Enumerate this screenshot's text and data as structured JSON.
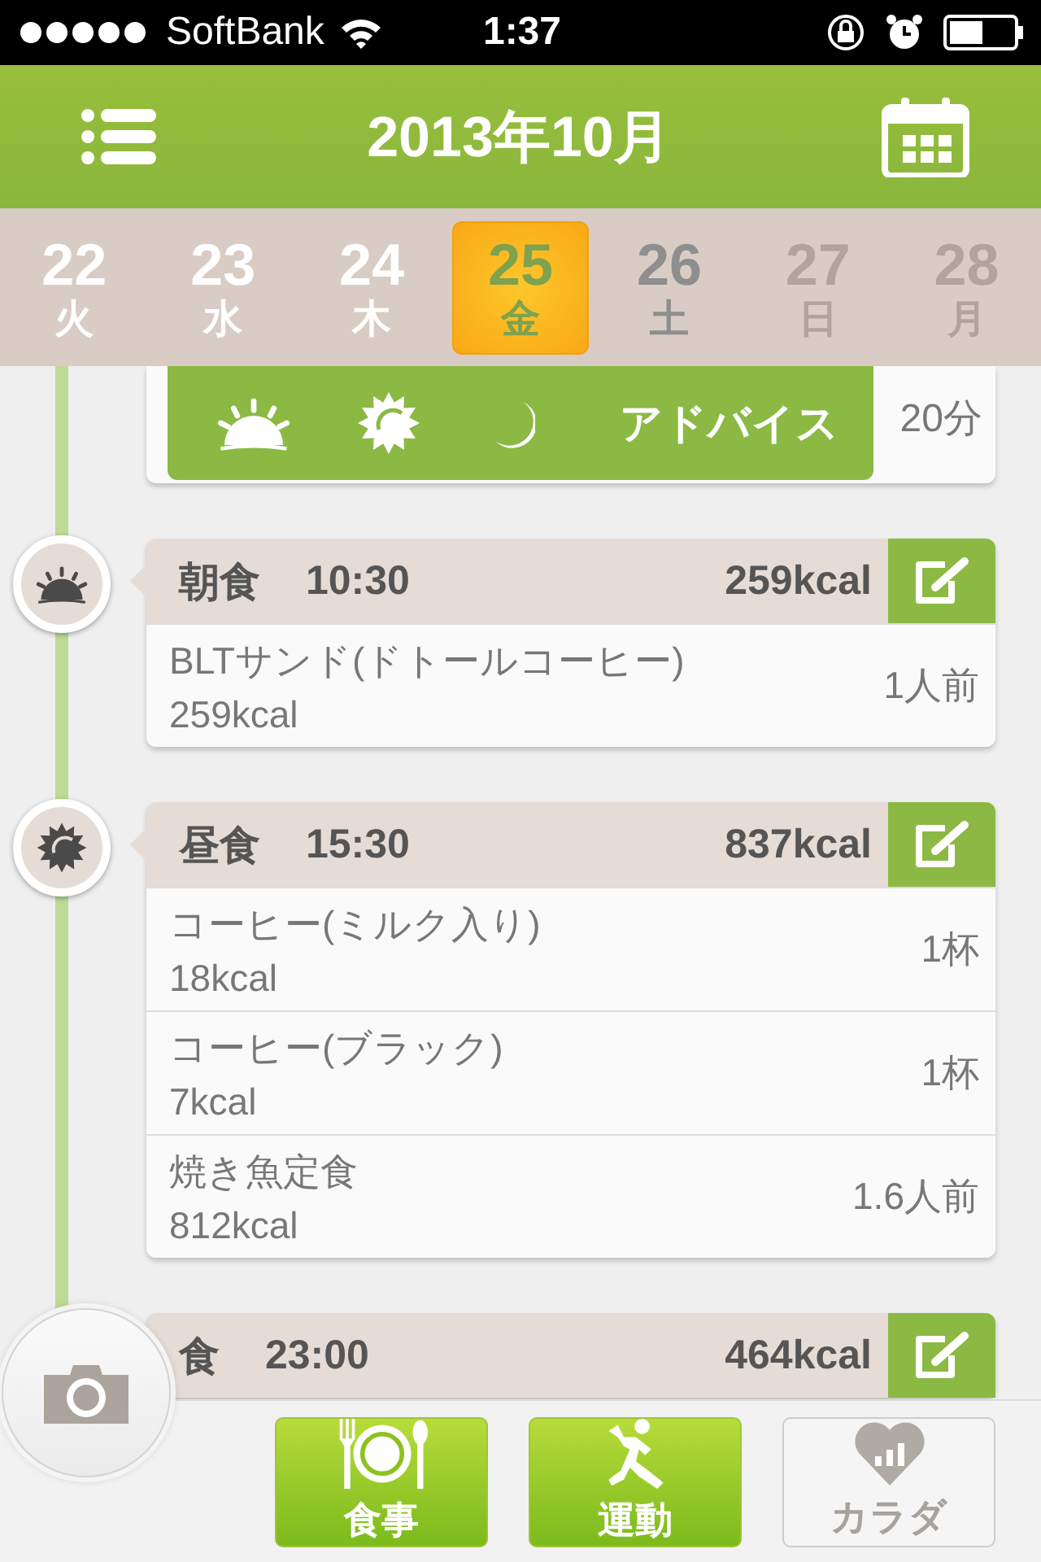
{
  "status_bar": {
    "carrier": "SoftBank",
    "time": "1:37"
  },
  "header": {
    "title": "2013年10月"
  },
  "days": [
    {
      "date": "22",
      "weekday": "火",
      "selected": false,
      "kind": "past"
    },
    {
      "date": "23",
      "weekday": "水",
      "selected": false,
      "kind": "past"
    },
    {
      "date": "24",
      "weekday": "木",
      "selected": false,
      "kind": "past"
    },
    {
      "date": "25",
      "weekday": "金",
      "selected": true,
      "kind": "past"
    },
    {
      "date": "26",
      "weekday": "土",
      "selected": false,
      "kind": "today"
    },
    {
      "date": "27",
      "weekday": "日",
      "selected": false,
      "kind": "future"
    },
    {
      "date": "28",
      "weekday": "月",
      "selected": false,
      "kind": "future"
    }
  ],
  "advice": {
    "label": "アドバイス",
    "duration": "20分"
  },
  "meals": [
    {
      "kind": "breakfast",
      "title": "朝食",
      "time": "10:30",
      "kcal": "259kcal",
      "items": [
        {
          "name": "BLTサンド(ドトールコーヒー)",
          "kcal": "259kcal",
          "portion": "1人前"
        }
      ]
    },
    {
      "kind": "lunch",
      "title": "昼食",
      "time": "15:30",
      "kcal": "837kcal",
      "items": [
        {
          "name": "コーヒー(ミルク入り)",
          "kcal": "18kcal",
          "portion": "1杯"
        },
        {
          "name": "コーヒー(ブラック)",
          "kcal": "7kcal",
          "portion": "1杯"
        },
        {
          "name": "焼き魚定食",
          "kcal": "812kcal",
          "portion": "1.6人前"
        }
      ]
    },
    {
      "kind": "dinner",
      "title": "食",
      "time": "23:00",
      "kcal": "464kcal"
    }
  ],
  "tabs": [
    {
      "kind": "meal",
      "label": "食事",
      "enabled": true
    },
    {
      "kind": "exercise",
      "label": "運動",
      "enabled": true
    },
    {
      "kind": "body",
      "label": "カラダ",
      "enabled": false
    }
  ]
}
